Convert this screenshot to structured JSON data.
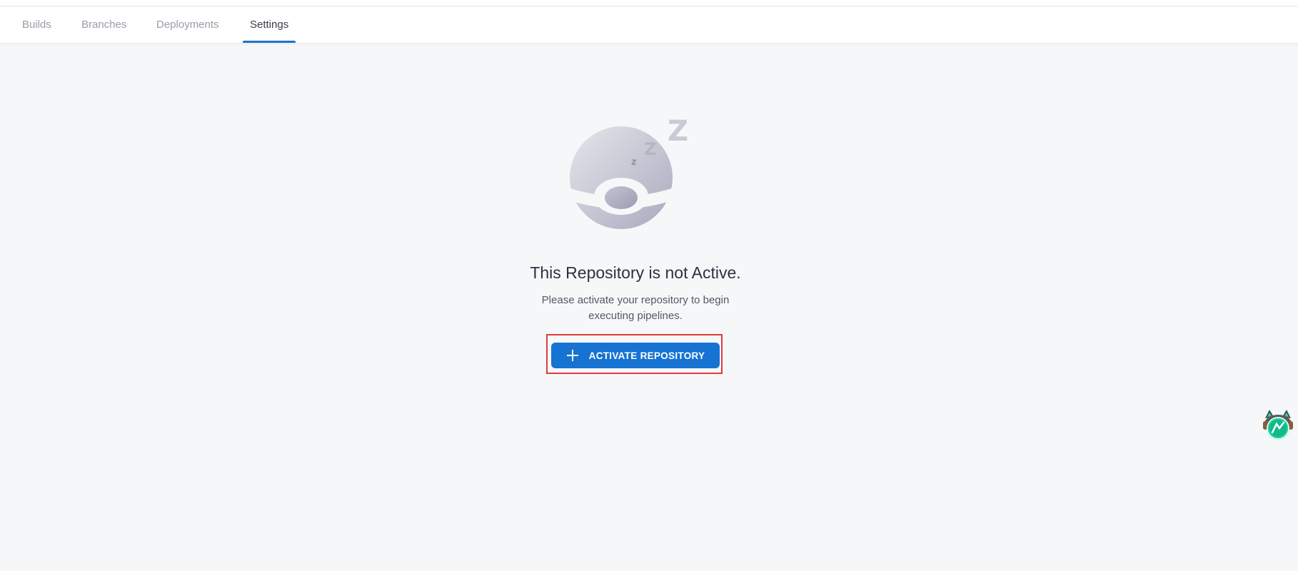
{
  "tabs": [
    {
      "label": "Builds",
      "active": false
    },
    {
      "label": "Branches",
      "active": false
    },
    {
      "label": "Deployments",
      "active": false
    },
    {
      "label": "Settings",
      "active": true
    }
  ],
  "empty_state": {
    "illustration": "sleeping-ball-icon",
    "title": "This Repository is not Active.",
    "description": "Please activate your repository to begin executing pipelines.",
    "button_icon": "plus-icon",
    "button_label": "ACTIVATE REPOSITORY"
  },
  "colors": {
    "accent": "#1773d2",
    "highlight_frame": "#e03a3a",
    "background": "#f6f7f9"
  },
  "floating_widget": {
    "icon": "assistant-cat-icon"
  }
}
